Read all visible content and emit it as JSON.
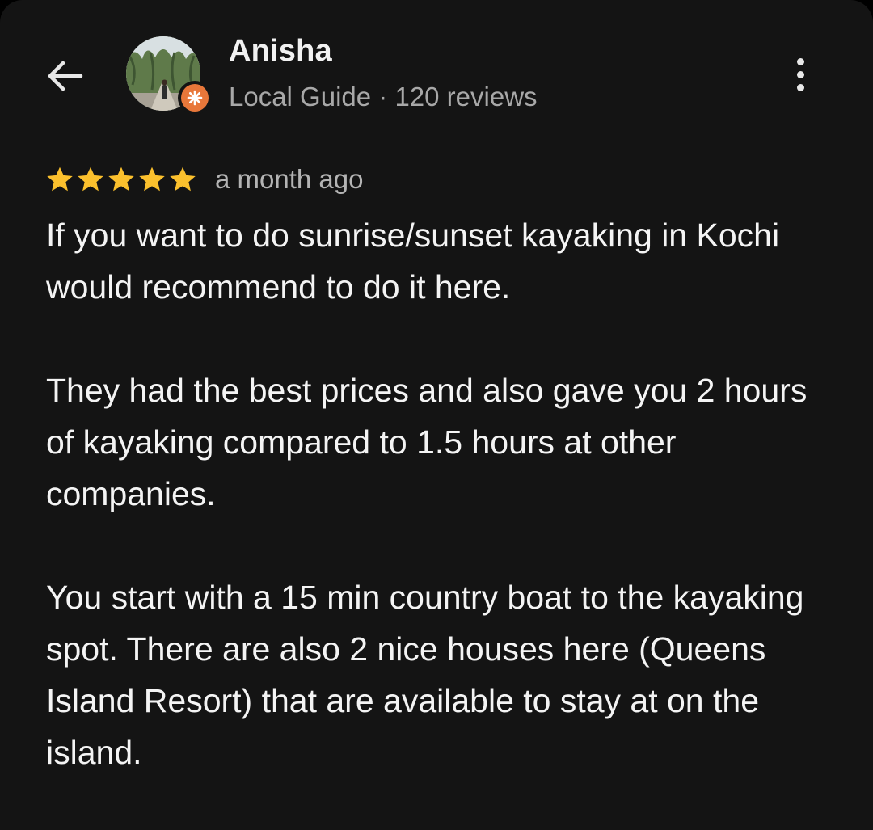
{
  "header": {
    "back_icon": "arrow-left-icon",
    "reviewer_name": "Anisha",
    "reviewer_meta": "Local Guide · 120 reviews",
    "badge_icon": "local-guide-star-icon",
    "badge_color": "#e8773a",
    "more_icon": "more-vertical-icon"
  },
  "review": {
    "rating": 5,
    "rating_max": 5,
    "star_color": "#fbc02d",
    "time_ago": "a month ago",
    "paragraphs": [
      "If you want to do sunrise/sunset kayaking in Kochi would recommend to do it here.",
      "They had the best prices and also gave you 2 hours of kayaking compared to 1.5 hours at other companies.",
      "You start with a 15 min country boat to the kayaking spot. There are also 2 nice houses here (Queens Island Resort) that are available to stay at on the island."
    ]
  }
}
